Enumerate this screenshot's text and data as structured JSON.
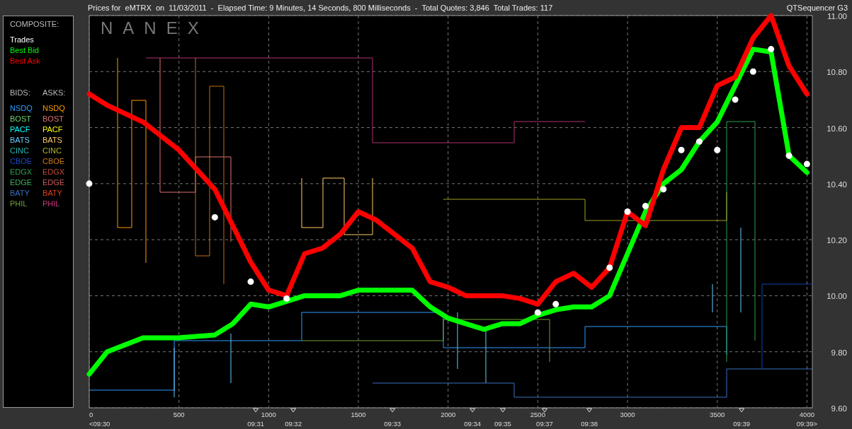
{
  "title_bar": {
    "caption": "Prices for  eMTRX  on  11/03/2011  -  Elapsed Time: 9 Minutes, 14 Seconds, 800 Milliseconds  -  Total Quotes: 3,846  Total Trades: 117",
    "app_name": "QTSequencer G3"
  },
  "legend": {
    "heading": "COMPOSITE:",
    "bids_heading": "BIDS:",
    "asks_heading": "ASKS:",
    "rows": [
      {
        "bid": {
          "label": "NSDQ",
          "color": "#2e9bff"
        },
        "ask": {
          "label": "NSDQ",
          "color": "#ff9900"
        }
      },
      {
        "bid": {
          "label": "BOST",
          "color": "#6fd36f"
        },
        "ask": {
          "label": "BOST",
          "color": "#e07070"
        }
      },
      {
        "bid": {
          "label": "PACF",
          "color": "#00ffff"
        },
        "ask": {
          "label": "PACF",
          "color": "#ffff00"
        }
      },
      {
        "bid": {
          "label": "BATS",
          "color": "#66ccff"
        },
        "ask": {
          "label": "BATS",
          "color": "#ffcc66"
        }
      },
      {
        "bid": {
          "label": "CINC",
          "color": "#22b5b5"
        },
        "ask": {
          "label": "CINC",
          "color": "#b5b522"
        }
      },
      {
        "bid": {
          "label": "CBOE",
          "color": "#1848c8"
        },
        "ask": {
          "label": "CBOE",
          "color": "#d07810"
        }
      },
      {
        "bid": {
          "label": "EDGX",
          "color": "#2fa050"
        },
        "ask": {
          "label": "EDGX",
          "color": "#c04a38"
        }
      },
      {
        "bid": {
          "label": "EDGE",
          "color": "#40b060"
        },
        "ask": {
          "label": "EDGE",
          "color": "#d05858"
        }
      },
      {
        "bid": {
          "label": "BATY",
          "color": "#3a70c0"
        },
        "ask": {
          "label": "BATY",
          "color": "#e04010"
        }
      },
      {
        "bid": {
          "label": "PHIL",
          "color": "#70a030"
        },
        "ask": {
          "label": "PHIL",
          "color": "#c03878"
        }
      }
    ]
  },
  "chart": {
    "brand": "NANEX",
    "chart_data": {
      "type": "line",
      "grid": true,
      "x": [
        0,
        100,
        300,
        500,
        700,
        800,
        900,
        1000,
        1100,
        1200,
        1300,
        1400,
        1500,
        1600,
        1700,
        1800,
        1900,
        2000,
        2100,
        2200,
        2300,
        2400,
        2500,
        2600,
        2700,
        2800,
        2900,
        3000,
        3100,
        3200,
        3300,
        3400,
        3500,
        3600,
        3700,
        3800,
        3900,
        4000
      ],
      "series": [
        {
          "name": "Trades",
          "color": "#ffffff",
          "type": "scatter",
          "values": [
            10.4,
            null,
            null,
            null,
            10.28,
            null,
            10.05,
            null,
            9.99,
            null,
            null,
            null,
            null,
            null,
            null,
            null,
            null,
            null,
            null,
            null,
            null,
            null,
            9.94,
            9.97,
            null,
            null,
            10.1,
            10.3,
            10.32,
            10.38,
            10.52,
            10.55,
            10.52,
            10.7,
            10.8,
            10.88,
            10.5,
            10.47
          ]
        },
        {
          "name": "Best Bid",
          "color": "#00ff00",
          "values": [
            9.72,
            9.8,
            9.85,
            9.85,
            9.86,
            9.9,
            9.97,
            9.96,
            9.98,
            10.0,
            10.0,
            10.0,
            10.02,
            10.02,
            10.02,
            10.02,
            9.96,
            9.92,
            9.9,
            9.88,
            9.9,
            9.9,
            9.93,
            9.95,
            9.96,
            9.96,
            10.0,
            10.15,
            10.3,
            10.4,
            10.45,
            10.55,
            10.62,
            10.75,
            10.88,
            10.87,
            10.5,
            10.44
          ]
        },
        {
          "name": "Best Ask",
          "color": "#ff0000",
          "values": [
            10.72,
            10.68,
            10.62,
            10.52,
            10.38,
            10.25,
            10.12,
            10.02,
            10.0,
            10.15,
            10.17,
            10.22,
            10.3,
            10.27,
            10.22,
            10.17,
            10.05,
            10.03,
            10.0,
            10.0,
            10.0,
            9.99,
            9.97,
            10.05,
            10.08,
            10.03,
            10.1,
            10.3,
            10.25,
            10.45,
            10.6,
            10.6,
            10.75,
            10.78,
            10.92,
            11.0,
            10.82,
            10.72
          ]
        }
      ],
      "xlim": [
        0,
        4030
      ],
      "ylim": [
        9.6,
        11.0
      ],
      "xticks": [
        0,
        500,
        1000,
        1500,
        2000,
        2500,
        3000,
        3500,
        4000
      ],
      "yticks": [
        {
          "value": 9.6,
          "label": "9.60"
        },
        {
          "value": 9.8,
          "label": "9.80"
        },
        {
          "value": 10.0,
          "label": "10.00"
        },
        {
          "value": 10.2,
          "label": "10.20"
        },
        {
          "value": 10.4,
          "label": "10.40"
        },
        {
          "value": 10.6,
          "label": "10.60"
        },
        {
          "value": 10.8,
          "label": "10.80"
        },
        {
          "value": 11.0,
          "label": "11.00"
        }
      ]
    },
    "time_axis": [
      "<09:30",
      "09:31",
      "09:32",
      "09:33",
      "09:34",
      "09:35",
      "09:37",
      "09:38",
      "09:39",
      "09:39>"
    ]
  }
}
